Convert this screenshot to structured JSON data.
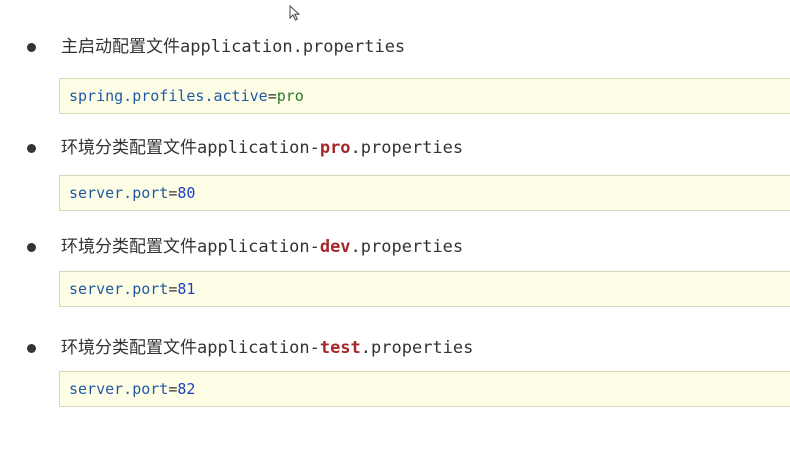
{
  "cursor_icon": "mouse-pointer-icon",
  "sections": [
    {
      "heading_prefix": "主启动配置文件application.properties",
      "heading_highlight": "",
      "heading_suffix": "",
      "code_key": "spring.profiles.active",
      "code_eq": "=",
      "code_value": "pro"
    },
    {
      "heading_prefix": "环境分类配置文件application-",
      "heading_highlight": "pro",
      "heading_suffix": ".properties",
      "code_key": "server.port",
      "code_eq": "=",
      "code_value": "80"
    },
    {
      "heading_prefix": "环境分类配置文件application-",
      "heading_highlight": "dev",
      "heading_suffix": ".properties",
      "code_key": "server.port",
      "code_eq": "=",
      "code_value": "81"
    },
    {
      "heading_prefix": "环境分类配置文件application-",
      "heading_highlight": "test",
      "heading_suffix": ".properties",
      "code_key": "server.port",
      "code_eq": "=",
      "code_value": "82"
    }
  ]
}
